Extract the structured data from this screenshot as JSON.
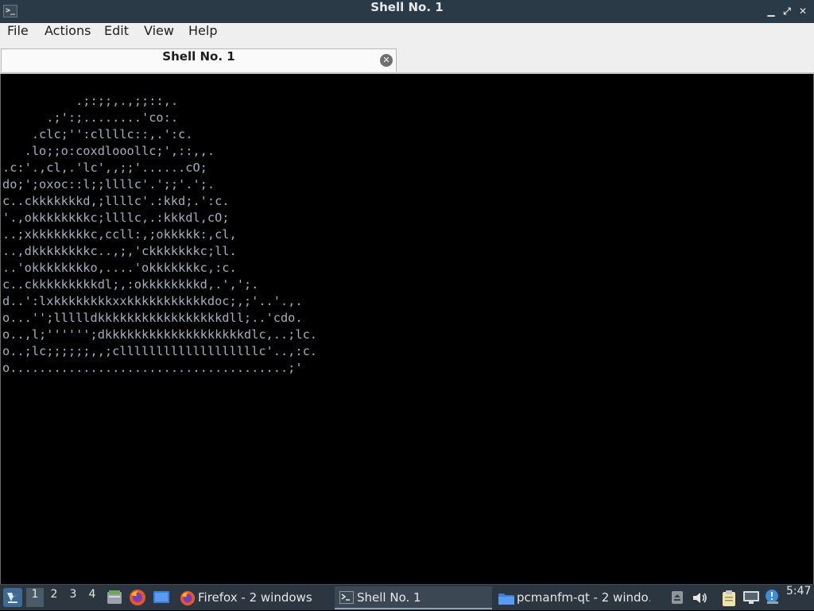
{
  "window": {
    "title": "Shell No. 1",
    "terminal_icon": ">_",
    "minimize_icon": "▁",
    "maximize_icon": "⤢",
    "close_icon": "✕"
  },
  "menubar": {
    "items": [
      "File",
      "Actions",
      "Edit",
      "View",
      "Help"
    ]
  },
  "tab": {
    "label": "Shell No. 1",
    "close_icon": "✕"
  },
  "terminal": {
    "lines": [
      "          .;:;;,.,;;::,.",
      "      .;':;........'co:.",
      "    .clc;'':cllllc::,.':c.",
      "   .lo;;o:coxdlooollc;',::,,.",
      ".c:'.,cl,.'lc',,;;'......cO;",
      "do;';oxoc::l;;llllc'.';;'.';.",
      "c..ckkkkkkkd,;llllc'.:kkd;.':c.",
      "'.,okkkkkkkkc;llllc,.:kkkdl,cO;",
      "..;xkkkkkkkkc,ccll:,;okkkkk:,cl,",
      "..,dkkkkkkkkc..,;,'ckkkkkkkc;ll.",
      "..'okkkkkkkko,....'okkkkkkkc,:c.",
      "c..ckkkkkkkkkdl;,:okkkkkkkkd,.',';.",
      "d..':lxkkkkkkkkxxkkkkkkkkkkkdoc;,;'..'.,.",
      "o...'';llllldkkkkkkkkkkkkkkkkkdll;..'cdo.",
      "o..,l;'''''';dkkkkkkkkkkkkkkkkkkkdlc,..;lc.",
      "o..;lc;;;;;;,,;clllllllllllllllllllc'..,:c.",
      "o......................................;'"
    ]
  },
  "taskbar": {
    "start_icon": "lxqt-start-icon",
    "desktops": [
      "1",
      "2",
      "3",
      "4"
    ],
    "active_desktop": "1",
    "quicklaunch": [
      "file-manager-icon",
      "firefox-icon",
      "show-desktop-icon"
    ],
    "tasks": [
      {
        "label": "Firefox - 2 windows",
        "icon": "firefox-icon"
      },
      {
        "label": "Shell No. 1",
        "icon": "terminal-icon"
      },
      {
        "label": "pcmanfm-qt - 2 windo…",
        "icon": "folder-icon"
      }
    ],
    "clock": "5:47"
  },
  "colors": {
    "titlebar": "#2b3a47",
    "menubar": "#efefef",
    "terminal_bg": "#000000",
    "terminal_fg": "#a3aebc",
    "taskbar": "#2b3640"
  }
}
